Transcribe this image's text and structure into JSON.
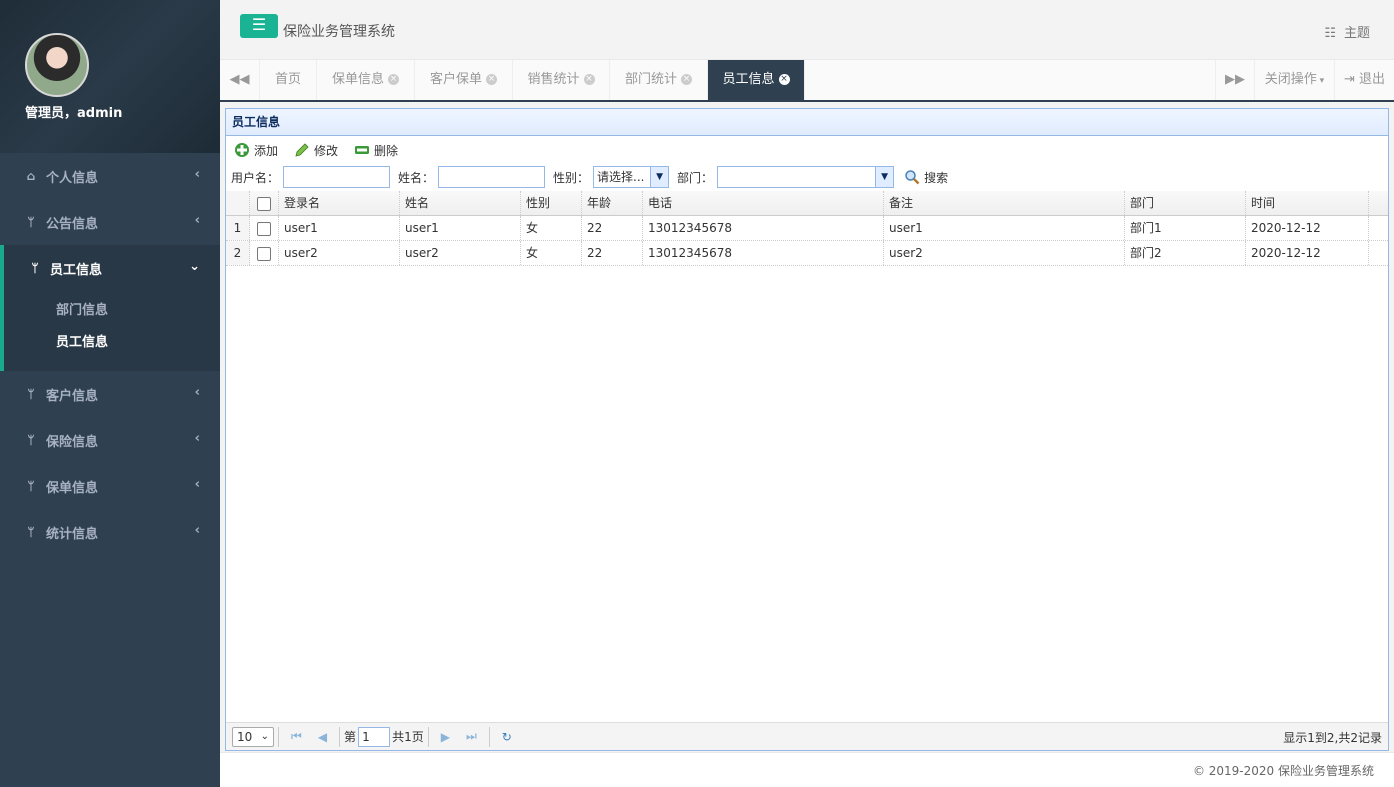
{
  "sidebar": {
    "user": "管理员，admin",
    "menu": [
      {
        "label": "个人信息",
        "icon": "home-icon"
      },
      {
        "label": "公告信息",
        "icon": "cutlery-icon"
      },
      {
        "label": "员工信息",
        "icon": "cutlery-icon"
      },
      {
        "label": "客户信息",
        "icon": "cutlery-icon"
      },
      {
        "label": "保险信息",
        "icon": "cutlery-icon"
      },
      {
        "label": "保单信息",
        "icon": "cutlery-icon"
      },
      {
        "label": "统计信息",
        "icon": "cutlery-icon"
      }
    ],
    "submenu": [
      "部门信息",
      "员工信息"
    ]
  },
  "header": {
    "system_title": "保险业务管理系统",
    "theme_label": "主题"
  },
  "tabs": {
    "home": "首页",
    "items": [
      "保单信息",
      "客户保单",
      "销售统计",
      "部门统计",
      "员工信息"
    ],
    "close_ops": "关闭操作",
    "logout": "退出"
  },
  "panel": {
    "title": "员工信息",
    "toolbar": {
      "add": "添加",
      "edit": "修改",
      "delete": "删除"
    },
    "filters": {
      "username_label": "用户名：",
      "name_label": "姓名：",
      "sex_label": "性别：",
      "sex_value": "请选择...",
      "dept_label": "部门：",
      "dept_value": "",
      "search": "搜索"
    },
    "columns": [
      "登录名",
      "姓名",
      "性别",
      "年龄",
      "电话",
      "备注",
      "部门",
      "时间"
    ],
    "rows": [
      {
        "num": "1",
        "login": "user1",
        "name": "user1",
        "sex": "女",
        "age": "22",
        "phone": "13012345678",
        "note": "user1",
        "dept": "部门1",
        "time": "2020-12-12"
      },
      {
        "num": "2",
        "login": "user2",
        "name": "user2",
        "sex": "女",
        "age": "22",
        "phone": "13012345678",
        "note": "user2",
        "dept": "部门2",
        "time": "2020-12-12"
      }
    ],
    "pager": {
      "page_size": "10",
      "page_prefix": "第",
      "page_value": "1",
      "page_total": "共1页",
      "info": "显示1到2,共2记录"
    }
  },
  "footer": {
    "copyright": "© 2019-2020 保险业务管理系统"
  },
  "colors": {
    "sidebar": "#2f4050",
    "accent": "#1ab394",
    "panel_border": "#95b8e7"
  }
}
